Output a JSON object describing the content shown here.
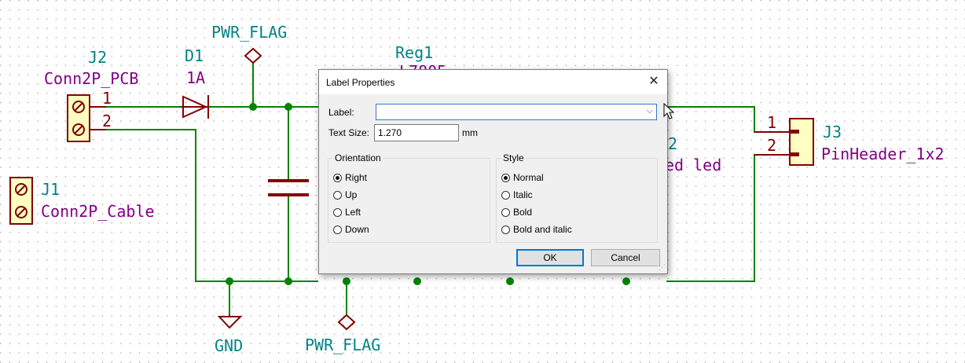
{
  "schematic": {
    "components": {
      "j2": {
        "ref": "J2",
        "value": "Conn2P_PCB",
        "pin1": "1",
        "pin2": "2"
      },
      "d1": {
        "ref": "D1",
        "value": "1A"
      },
      "pwr_flag_top": {
        "value": "PWR_FLAG"
      },
      "reg1": {
        "ref": "Reg1",
        "value_partial": "L7805"
      },
      "j1": {
        "ref": "J1",
        "value": "Conn2P_Cable"
      },
      "led": {
        "ref_partial": "2",
        "value_partial": "ed led"
      },
      "j3": {
        "ref": "J3",
        "value": "PinHeader_1x2",
        "pin1": "1",
        "pin2": "2"
      },
      "gnd": {
        "value": "GND"
      },
      "pwr_flag_bottom": {
        "value": "PWR_FLAG"
      }
    },
    "colors": {
      "wire": "#008400",
      "body": "#840000",
      "fill": "#ffffc2",
      "ref": "#008484",
      "value": "#840084",
      "grid": "#a0a0a0"
    }
  },
  "dialog": {
    "title": "Label Properties",
    "close_glyph": "✕",
    "label_caption": "Label:",
    "label_value": "",
    "text_size_caption": "Text Size:",
    "text_size_value": "1.270",
    "units": "mm",
    "orientation": {
      "title": "Orientation",
      "options": [
        "Right",
        "Up",
        "Left",
        "Down"
      ],
      "selected": "Right"
    },
    "style": {
      "title": "Style",
      "options": [
        "Normal",
        "Italic",
        "Bold",
        "Bold and italic"
      ],
      "selected": "Normal"
    },
    "ok_label": "OK",
    "cancel_label": "Cancel"
  }
}
